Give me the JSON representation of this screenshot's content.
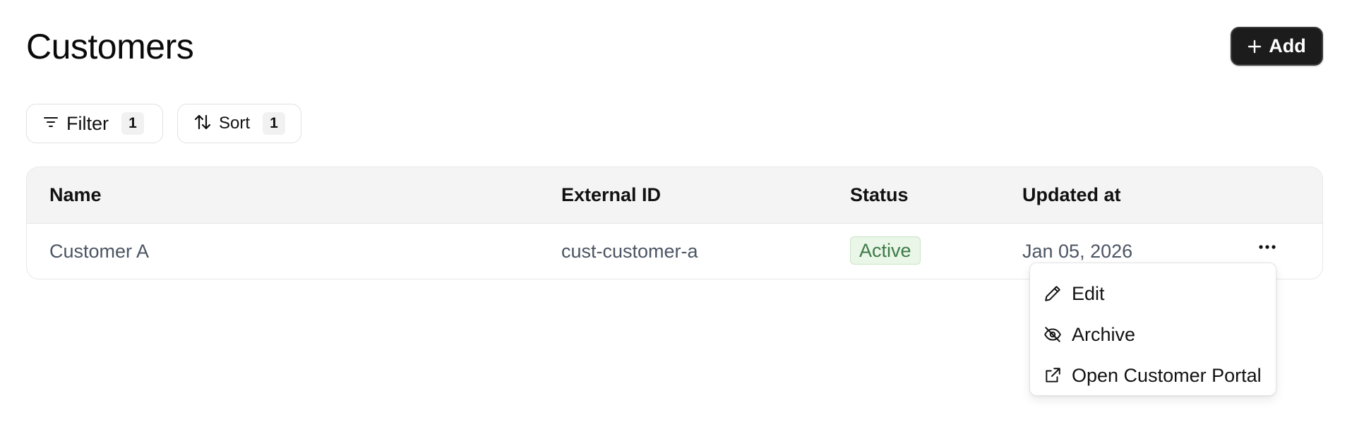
{
  "header": {
    "title": "Customers",
    "add_label": "Add"
  },
  "toolbar": {
    "filter": {
      "label": "Filter",
      "count": "1"
    },
    "sort": {
      "label": "Sort",
      "count": "1"
    }
  },
  "table": {
    "columns": [
      "Name",
      "External ID",
      "Status",
      "Updated at"
    ],
    "rows": [
      {
        "name": "Customer A",
        "external_id": "cust-customer-a",
        "status": "Active",
        "updated_at": "Jan 05, 2026"
      }
    ]
  },
  "row_menu": {
    "items": [
      {
        "label": "Edit",
        "icon": "pencil-icon"
      },
      {
        "label": "Archive",
        "icon": "eye-off-icon"
      },
      {
        "label": "Open Customer Portal",
        "icon": "external-link-icon"
      }
    ]
  },
  "colors": {
    "add_button_bg": "#1c1c1c",
    "status_active_bg": "#eaf6e7",
    "status_active_text": "#3e7a48",
    "table_header_bg": "#f4f4f4"
  }
}
